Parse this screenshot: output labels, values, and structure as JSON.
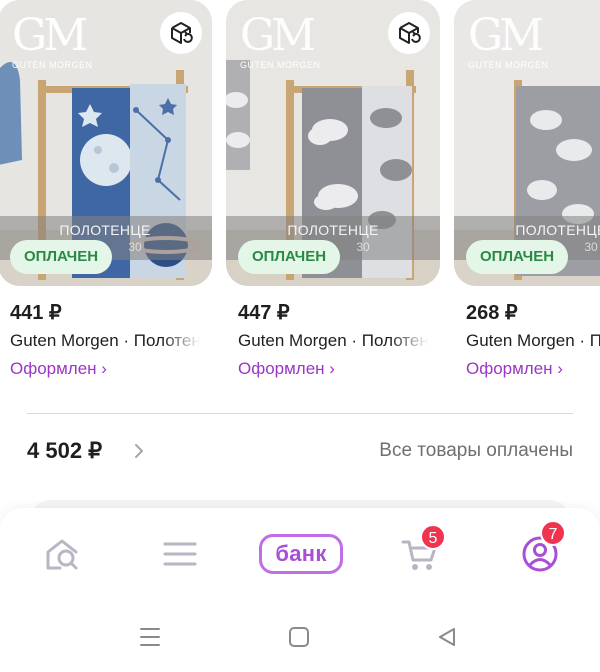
{
  "products": [
    {
      "brand_mark": "GM",
      "brand_name": "GUTEN MORGEN",
      "category": "ПОЛОТЕНЦЕ",
      "category_sub": "30",
      "badge": "ОПЛАЧЕН",
      "price": "441 ₽",
      "title": "Guten Morgen · Полотенце",
      "status": "Оформлен ›"
    },
    {
      "brand_mark": "GM",
      "brand_name": "GUTEN MORGEN",
      "category": "ПОЛОТЕНЦЕ",
      "category_sub": "30",
      "badge": "ОПЛАЧЕН",
      "price": "447 ₽",
      "title": "Guten Morgen · Полотенце",
      "status": "Оформлен ›"
    },
    {
      "brand_mark": "GM",
      "brand_name": "GUTEN MORGEN",
      "category": "ПОЛОТЕНЦЕ",
      "category_sub": "30",
      "badge": "ОПЛАЧЕН",
      "price": "268 ₽",
      "title": "Guten Morgen · Полотенце",
      "status": "Оформлен ›"
    }
  ],
  "order_summary": {
    "total": "4 502 ₽",
    "status": "Все товары оплачены"
  },
  "tabbar": {
    "items": [
      {
        "name": "home",
        "icon": "home-search-icon"
      },
      {
        "name": "catalog",
        "icon": "menu-icon"
      },
      {
        "name": "bank",
        "label": "банк"
      },
      {
        "name": "cart",
        "icon": "cart-icon",
        "badge": "5"
      },
      {
        "name": "profile",
        "icon": "profile-icon",
        "badge": "7"
      }
    ]
  },
  "system_nav": [
    "recents-icon",
    "home-icon",
    "back-icon"
  ],
  "colors": {
    "accent": "#a94fd6",
    "paid_badge_bg": "#e3f6e7",
    "paid_badge_text": "#2a8a45",
    "notification": "#f0334f"
  }
}
